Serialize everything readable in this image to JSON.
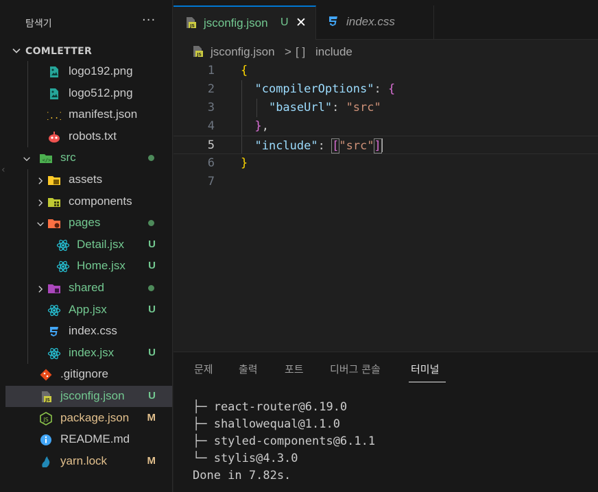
{
  "sidebar": {
    "title": "탐색기",
    "more": "···",
    "root": "COMLETTER",
    "items": [
      {
        "name": "logo192.png",
        "badge": "",
        "dot": false,
        "color": "#cccccc",
        "icon": "image-icon",
        "chevron": ""
      },
      {
        "name": "logo512.png",
        "badge": "",
        "dot": false,
        "color": "#cccccc",
        "icon": "image-icon",
        "chevron": ""
      },
      {
        "name": "manifest.json",
        "badge": "",
        "dot": false,
        "color": "#cccccc",
        "icon": "json-icon",
        "chevron": ""
      },
      {
        "name": "robots.txt",
        "badge": "",
        "dot": false,
        "color": "#cccccc",
        "icon": "robot-icon",
        "chevron": ""
      },
      {
        "name": "src",
        "badge": "",
        "dot": true,
        "color": "#73c991",
        "icon": "folder-src-icon",
        "chevron": "down"
      },
      {
        "name": "assets",
        "badge": "",
        "dot": false,
        "color": "#cccccc",
        "icon": "folder-assets-icon",
        "chevron": "right"
      },
      {
        "name": "components",
        "badge": "",
        "dot": false,
        "color": "#cccccc",
        "icon": "folder-components-icon",
        "chevron": "right"
      },
      {
        "name": "pages",
        "badge": "",
        "dot": true,
        "color": "#73c991",
        "icon": "folder-pages-icon",
        "chevron": "down"
      },
      {
        "name": "Detail.jsx",
        "badge": "U",
        "dot": false,
        "color": "#73c991",
        "icon": "react-icon",
        "chevron": ""
      },
      {
        "name": "Home.jsx",
        "badge": "U",
        "dot": false,
        "color": "#73c991",
        "icon": "react-icon",
        "chevron": ""
      },
      {
        "name": "shared",
        "badge": "",
        "dot": true,
        "color": "#73c991",
        "icon": "folder-shared-icon",
        "chevron": "right"
      },
      {
        "name": "App.jsx",
        "badge": "U",
        "dot": false,
        "color": "#73c991",
        "icon": "react-icon",
        "chevron": ""
      },
      {
        "name": "index.css",
        "badge": "",
        "dot": false,
        "color": "#cccccc",
        "icon": "css-icon",
        "chevron": ""
      },
      {
        "name": "index.jsx",
        "badge": "U",
        "dot": false,
        "color": "#73c991",
        "icon": "react-icon",
        "chevron": ""
      },
      {
        "name": ".gitignore",
        "badge": "",
        "dot": false,
        "color": "#cccccc",
        "icon": "git-icon",
        "chevron": ""
      },
      {
        "name": "jsconfig.json",
        "badge": "U",
        "dot": false,
        "color": "#73c991",
        "icon": "jsconfig-icon",
        "chevron": "",
        "selected": true
      },
      {
        "name": "package.json",
        "badge": "M",
        "dot": false,
        "color": "#e2c08d",
        "icon": "nodejs-icon",
        "chevron": ""
      },
      {
        "name": "README.md",
        "badge": "",
        "dot": false,
        "color": "#cccccc",
        "icon": "info-icon",
        "chevron": ""
      },
      {
        "name": "yarn.lock",
        "badge": "M",
        "dot": false,
        "color": "#e2c08d",
        "icon": "yarn-icon",
        "chevron": ""
      }
    ]
  },
  "tabs": [
    {
      "label": "jsconfig.json",
      "badge": "U",
      "close": "✕",
      "active": true
    },
    {
      "label": "index.css",
      "badge": "",
      "close": "",
      "active": false
    }
  ],
  "breadcrumb": {
    "file": "jsconfig.json",
    "separator": ">",
    "symbol": "[ ]",
    "item": "include"
  },
  "editor": {
    "line_numbers": [
      "1",
      "2",
      "3",
      "4",
      "5",
      "6",
      "7"
    ],
    "current_line": "5",
    "tokens": {
      "open_brace": "{",
      "key1": "\"compilerOptions\"",
      "colon": ": ",
      "open_brace2": "{",
      "key2": "\"baseUrl\"",
      "val2": "\"src\"",
      "close_brace2": "}",
      "comma": ",",
      "key3": "\"include\"",
      "open_bracket": "[",
      "val3": "\"src\"",
      "close_bracket": "]",
      "close_brace": "}"
    }
  },
  "panel": {
    "tabs": [
      "문제",
      "출력",
      "포트",
      "디버그 콘솔",
      "터미널"
    ],
    "active_tab": "터미널",
    "terminal_lines": [
      "├─ react-router@6.19.0",
      "├─ shallowequal@1.1.0",
      "├─ styled-components@6.1.1",
      "└─ stylis@4.3.0",
      "Done in 7.82s."
    ]
  },
  "colors": {
    "accent": "#0078d4",
    "untracked": "#73c991",
    "modified": "#e2c08d"
  }
}
